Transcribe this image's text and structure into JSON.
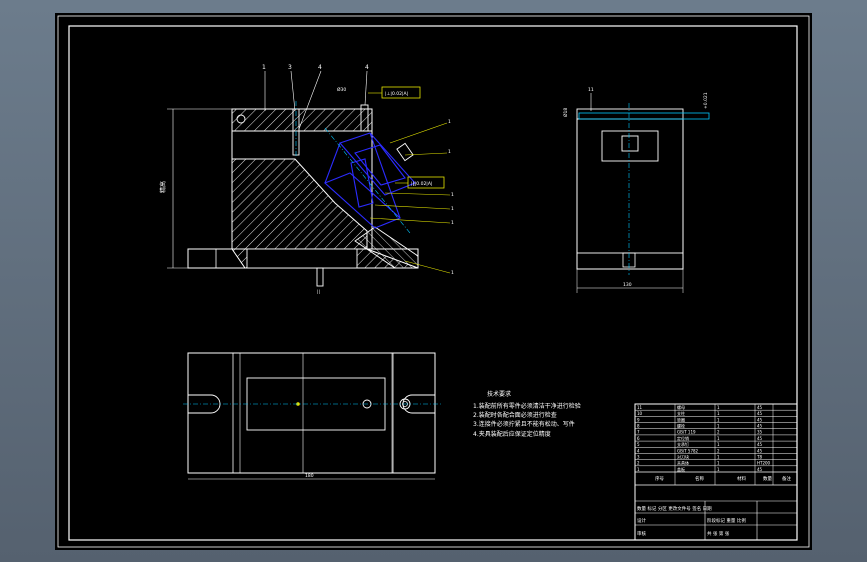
{
  "colors": {
    "background": "#000000",
    "outline": "#ffffff",
    "hatch": "#ffffff",
    "centerline": "#00c8ff",
    "leader": "#ffff00",
    "part_blue": "#2c2cff",
    "accent_yellow": "#e6e600"
  },
  "front_view": {
    "balloons": [
      "1",
      "3",
      "4",
      "4"
    ],
    "right_balloons": [
      "1",
      "1",
      "1",
      "1",
      "1",
      "1"
    ],
    "tolerance_label": "|⊥|0.02|A|",
    "datum_label": "|∥|0.02|A|",
    "height_dim": "精高",
    "dim_top": "Ø30",
    "bottom_dim": "||"
  },
  "side_view": {
    "balloon": "11",
    "width_dim": "130",
    "dim_left": "Ø18",
    "dim_right": "+0.021"
  },
  "top_view": {
    "width_dim": "180"
  },
  "notes": {
    "title": "技术要求",
    "lines": [
      "1.装配前所有零件必须清洁干净进行检验",
      "2.装配时各配合面必须进行检查",
      "3.连接件必须拧紧且不能有松动、写件",
      "4.夹具装配后应保证定位精度"
    ]
  },
  "title_block": {
    "header": [
      "序号",
      "名称",
      "材料",
      "数量",
      "备注"
    ],
    "rows": [
      [
        "11",
        "螺母",
        "1",
        "45"
      ],
      [
        "10",
        "支柱",
        "1",
        "45"
      ],
      [
        "9",
        "垫圈",
        "1",
        "45"
      ],
      [
        "8",
        "螺栓",
        "1",
        "45"
      ],
      [
        "7",
        "GB/T 119",
        "2",
        "35"
      ],
      [
        "6",
        "定位销",
        "1",
        "45"
      ],
      [
        "5",
        "支承钉",
        "1",
        "45"
      ],
      [
        "4",
        "GB/T 5782",
        "2",
        "45"
      ],
      [
        "3",
        "对刀块",
        "1",
        "T8"
      ],
      [
        "2",
        "夹具体",
        "1",
        "HT200"
      ],
      [
        "1",
        "盖板",
        "1",
        "45"
      ]
    ],
    "footer_left": "数量 标记 分区 更改文件号 签名 日期",
    "footer_mid": "阶段标记 重量 比例",
    "footer_right": "共 张 第 张",
    "design": "设计",
    "check": "审核"
  }
}
